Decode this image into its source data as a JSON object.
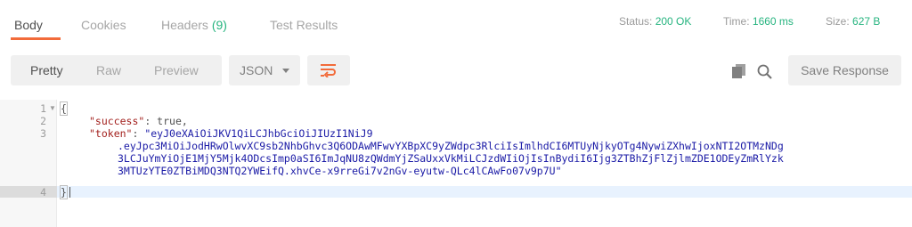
{
  "tabs": [
    {
      "label": "Body",
      "active": true
    },
    {
      "label": "Cookies",
      "active": false
    },
    {
      "label": "Headers",
      "count": "(9)",
      "active": false
    },
    {
      "label": "Test Results",
      "active": false
    }
  ],
  "stats": {
    "status_label": "Status:",
    "status_value": "200 OK",
    "time_label": "Time:",
    "time_value": "1660 ms",
    "size_label": "Size:",
    "size_value": "627 B"
  },
  "toolbar": {
    "views": [
      "Pretty",
      "Raw",
      "Preview"
    ],
    "active_view": "Pretty",
    "format": "JSON",
    "wrap_icon": "wrap-lines-icon",
    "copy_icon": "copy-icon",
    "search_icon": "search-icon",
    "save_label": "Save Response"
  },
  "editor": {
    "line_numbers": [
      "1",
      "2",
      "3",
      "4"
    ],
    "lines": {
      "open_brace": "{",
      "success_key": "\"success\"",
      "success_value": "true",
      "token_key": "\"token\"",
      "token_part1": "\"eyJ0eXAiOiJKV1QiLCJhbGciOiJIUzI1NiJ9",
      "token_part2": ".eyJpc3MiOiJodHRwOlwvXC9sb2NhbGhvc3Q6ODAwMFwvYXBpXC9yZWdpc3RlciIsImlhdCI6MTUyNjkyOTg4NywiZXhwIjoxNTI2OTMzNDg",
      "token_part3": "3LCJuYmYiOjE1MjY5Mjk4ODcsImp0aSI6ImJqNU8zQWdmYjZSaUxxVkMiLCJzdWIiOjIsInBydiI6Ijg3ZTBhZjFlZjlmZDE1ODEyZmRlYzk",
      "token_part4": "3MTUzYTE0ZTBiMDQ3NTQ2YWEifQ.xhvCe-x9rreGi7v2nGv-eyutw-QLc4lCAwFo07v9p7U\"",
      "close_brace": "}"
    }
  },
  "colors": {
    "accent": "#f26b3a",
    "success": "#26b47f",
    "json_key": "#a3211e",
    "json_string": "#1a1aa6"
  }
}
